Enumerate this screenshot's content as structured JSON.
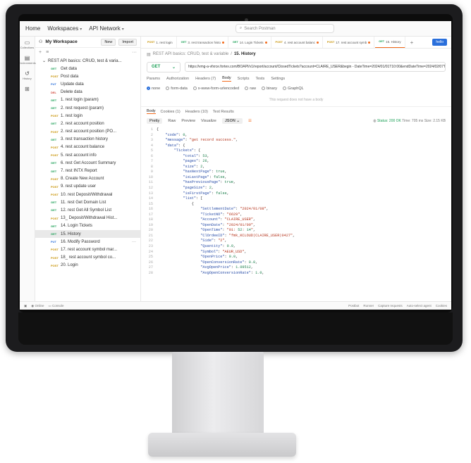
{
  "topbar": {
    "home": "Home",
    "workspaces": "Workspaces",
    "api_network": "API Network",
    "search_placeholder": "Search Postman"
  },
  "rail": [
    {
      "label": "Collections",
      "icon": "collections-icon"
    },
    {
      "label": "Environments",
      "icon": "environments-icon"
    },
    {
      "label": "History",
      "icon": "history-icon"
    },
    {
      "label": "",
      "icon": "apps-icon"
    }
  ],
  "sidebar": {
    "workspace": "My Workspace",
    "new_label": "New",
    "import_label": "Import",
    "collection": "REST API basics: CRUD, test & varia...",
    "items": [
      {
        "m": "GET",
        "label": "Get data"
      },
      {
        "m": "POST",
        "label": "Post data"
      },
      {
        "m": "PUT",
        "label": "Update data"
      },
      {
        "m": "DEL",
        "label": "Delete data"
      },
      {
        "m": "GET",
        "label": "1. rest login (param)"
      },
      {
        "m": "GET",
        "label": "2. rest request (param)"
      },
      {
        "m": "POST",
        "label": "1. rest login"
      },
      {
        "m": "GET",
        "label": "2. rest account position"
      },
      {
        "m": "POST",
        "label": "2. rest account position (PO..."
      },
      {
        "m": "GET",
        "label": "3. rest transaction history"
      },
      {
        "m": "POST",
        "label": "4. rest account balance"
      },
      {
        "m": "POST",
        "label": "5. rest account info"
      },
      {
        "m": "GET",
        "label": "6. rest Get Account Summary"
      },
      {
        "m": "GET",
        "label": "7. rest INTX Report"
      },
      {
        "m": "POST",
        "label": "8. Create New Account"
      },
      {
        "m": "POST",
        "label": "9. rest update user"
      },
      {
        "m": "POST",
        "label": "10. rest Deposit/Withdrawal"
      },
      {
        "m": "GET",
        "label": "11. rest Get Domain List"
      },
      {
        "m": "GET",
        "label": "12. rest Get All Symbol List"
      },
      {
        "m": "POST",
        "label": "13_ Deposit/Withdrawal Hist..."
      },
      {
        "m": "GET",
        "label": "14. Login Tickets"
      },
      {
        "m": "GET",
        "label": "15. History"
      },
      {
        "m": "PUT",
        "label": "16. Modify Password"
      },
      {
        "m": "POST",
        "label": "17. rest account symbol mar..."
      },
      {
        "m": "POST",
        "label": "18_ rest account symbol co..."
      },
      {
        "m": "POST",
        "label": "20. Login"
      }
    ],
    "active_index": 21
  },
  "tabs": [
    {
      "m": "POST",
      "label": "1. rest login",
      "dot": false
    },
    {
      "m": "GET",
      "label": "3. rest transaction histo",
      "dot": true
    },
    {
      "m": "GET",
      "label": "14. Login Tickets",
      "dot": true
    },
    {
      "m": "POST",
      "label": "4. rest account balanc",
      "dot": true
    },
    {
      "m": "POST",
      "label": "17. rest account symb",
      "dot": true
    },
    {
      "m": "GET",
      "label": "15. History",
      "dot": false
    }
  ],
  "hello_label": "hello",
  "breadcrumb": {
    "collection": "REST API basics: CRUD, test & variable",
    "request": "15. History"
  },
  "request": {
    "method": "GET",
    "url": "https://vmg-a-vfxrce.fortex.com/BOAPI/v1/report/account/ClosedTickets?account=CLAIRE_USER&begin - DateTime=2024/01/01T10:00&endDateTime=2024/02/07T10:00&pagenum=1&pagesize=1&symbol=..."
  },
  "request_tabs": [
    "Params",
    "Authorization",
    "Headers (7)",
    "Body",
    "Scripts",
    "Tests",
    "Settings"
  ],
  "body_options": [
    "none",
    "form-data",
    "x-www-form-urlencoded",
    "raw",
    "binary",
    "GraphQL"
  ],
  "no_body_note": "This request does not have a body",
  "response_tabs": [
    "Body",
    "Cookies (1)",
    "Headers (10)",
    "Test Results"
  ],
  "response_tools": {
    "pretty": "Pretty",
    "raw": "Raw",
    "preview": "Preview",
    "visualize": "Visualize",
    "format": "JSON"
  },
  "response_status": {
    "status": "Status: 200 OK",
    "time": "Time: 705 ms",
    "size": "Size: 2.15 KB"
  },
  "statusbar": {
    "online": "Online",
    "console": "Console",
    "postbot": "Postbot",
    "runner": "Runner",
    "capture": "Capture requests",
    "auto_agent": "Auto-select agent",
    "cookies": "Cookies"
  },
  "code_lines": [
    "{",
    "    \"code\": 0,",
    "    \"message\": \"get record success.\",",
    "    \"data\": {",
    "        \"Tickets\": {",
    "            \"total\": 53,",
    "            \"pages\": 26,",
    "            \"size\": 2,",
    "            \"hasNextPage\": true,",
    "            \"isLastPage\": false,",
    "            \"hasPreviousPage\": true,",
    "            \"pageSize\": 2,",
    "            \"isFirstPage\": false,",
    "            \"list\": [",
    "                {",
    "                    \"SettlementDate\": \"2024/01/08\",",
    "                    \"TicketNO\": \"6629\",",
    "                    \"Account\": \"CLAIRE_USER\",",
    "                    \"OpenDate\": \"2024/01/09\",",
    "                    \"OpenTime\": \"01:52:14\",",
    "                    \"ClOrdeeID\": \"fmk_KCLOUD|CLAIRE_USER|0427\",",
    "                    \"Side\": \"2\",",
    "                    \"Quantity\": 0.0,",
    "                    \"Symbol\": \"AEUR_USD\",",
    "                    \"OpenPrice\": 0.0,",
    "                    \"OpenConversionRate\": 0.0,",
    "                    \"AvgOpenPrice\": 1.09512,",
    "                    \"AvgOpenConversionRate\": 1.0,"
  ]
}
